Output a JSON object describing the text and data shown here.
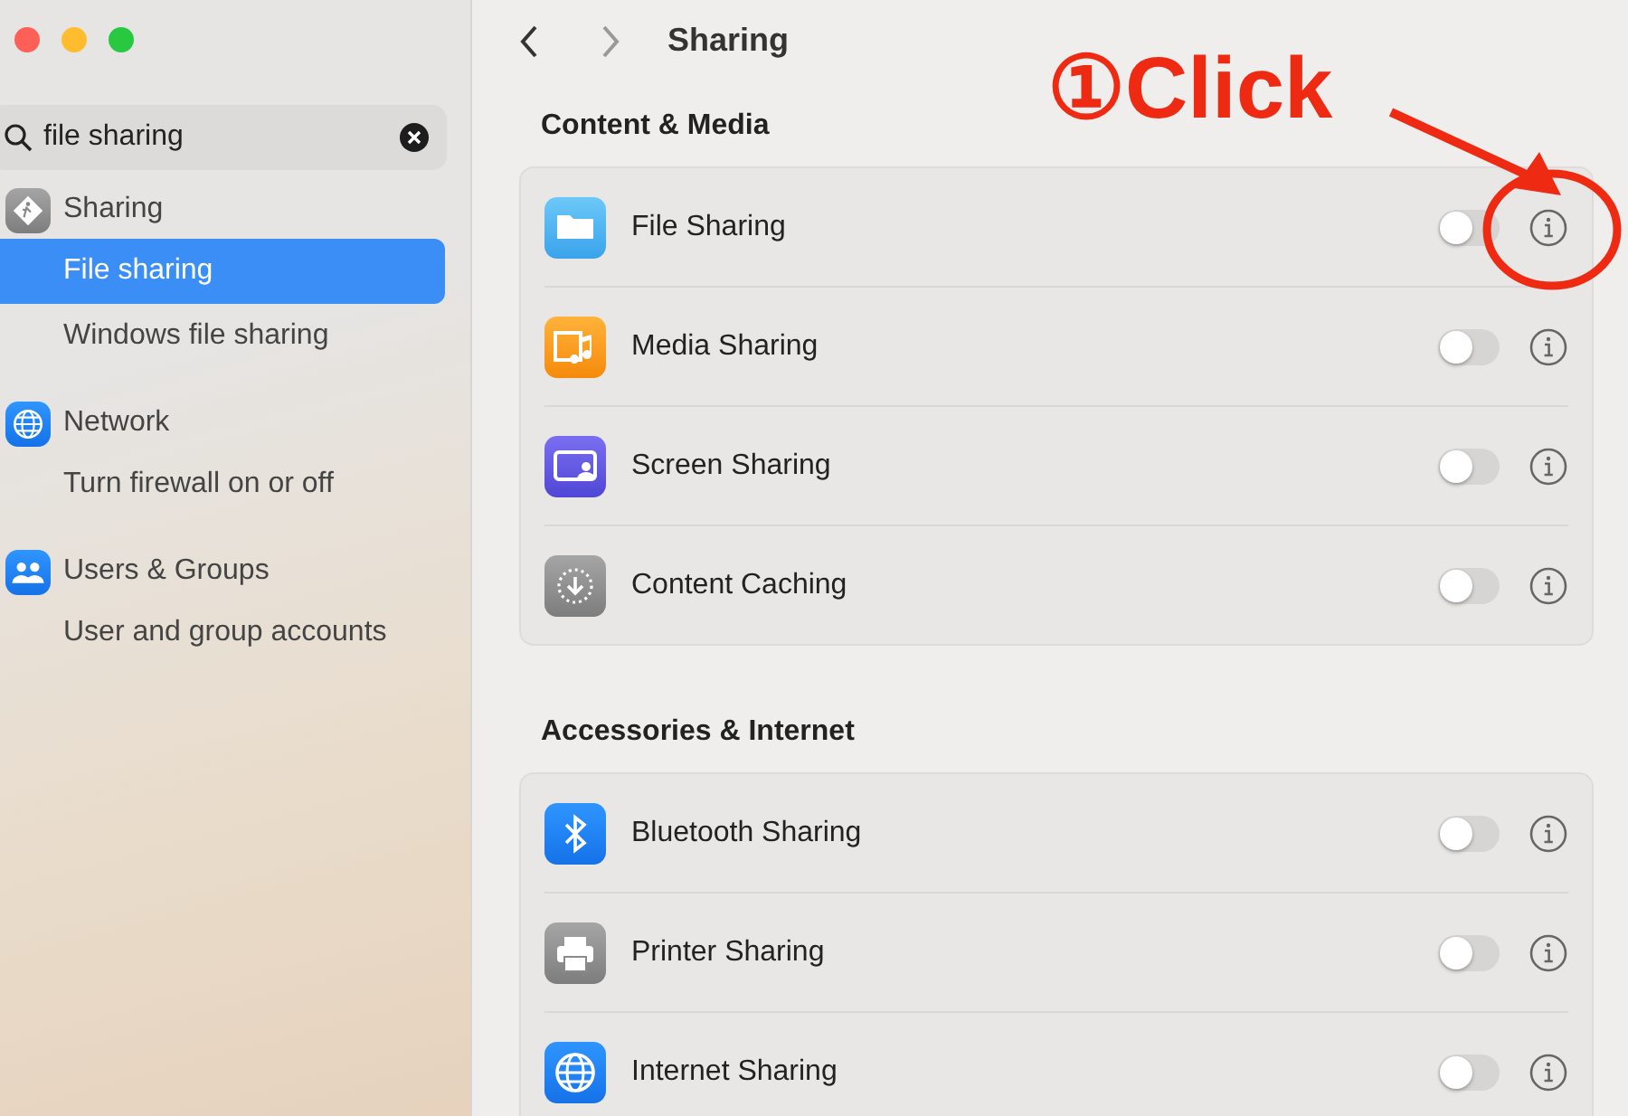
{
  "window": {
    "controls": [
      {
        "kind": "close"
      },
      {
        "kind": "minimize"
      },
      {
        "kind": "zoom"
      }
    ]
  },
  "search": {
    "value": "file sharing"
  },
  "sidebar": {
    "groups": [
      {
        "title": "Sharing",
        "kind": "sharing",
        "items": [
          {
            "label": "File sharing",
            "selected": true
          },
          {
            "label": "Windows file sharing",
            "selected": false
          }
        ]
      },
      {
        "title": "Network",
        "kind": "globe",
        "items": [
          {
            "label": "Turn firewall on or off",
            "selected": false
          }
        ]
      },
      {
        "title": "Users & Groups",
        "kind": "users",
        "items": [
          {
            "label": "User and group accounts",
            "selected": false
          }
        ]
      }
    ]
  },
  "toolbar": {
    "title": "Sharing"
  },
  "sections": [
    {
      "title": "Content & Media",
      "rows": [
        {
          "label": "File Sharing",
          "kind": "folder",
          "on": false
        },
        {
          "label": "Media Sharing",
          "kind": "media",
          "on": false
        },
        {
          "label": "Screen Sharing",
          "kind": "screen",
          "on": false
        },
        {
          "label": "Content Caching",
          "kind": "download",
          "on": false
        }
      ]
    },
    {
      "title": "Accessories & Internet",
      "rows": [
        {
          "label": "Bluetooth Sharing",
          "kind": "bluetooth",
          "on": false
        },
        {
          "label": "Printer Sharing",
          "kind": "printer",
          "on": false
        },
        {
          "label": "Internet Sharing",
          "kind": "globe",
          "on": false
        }
      ]
    }
  ],
  "annotation": {
    "text": "①Click"
  }
}
